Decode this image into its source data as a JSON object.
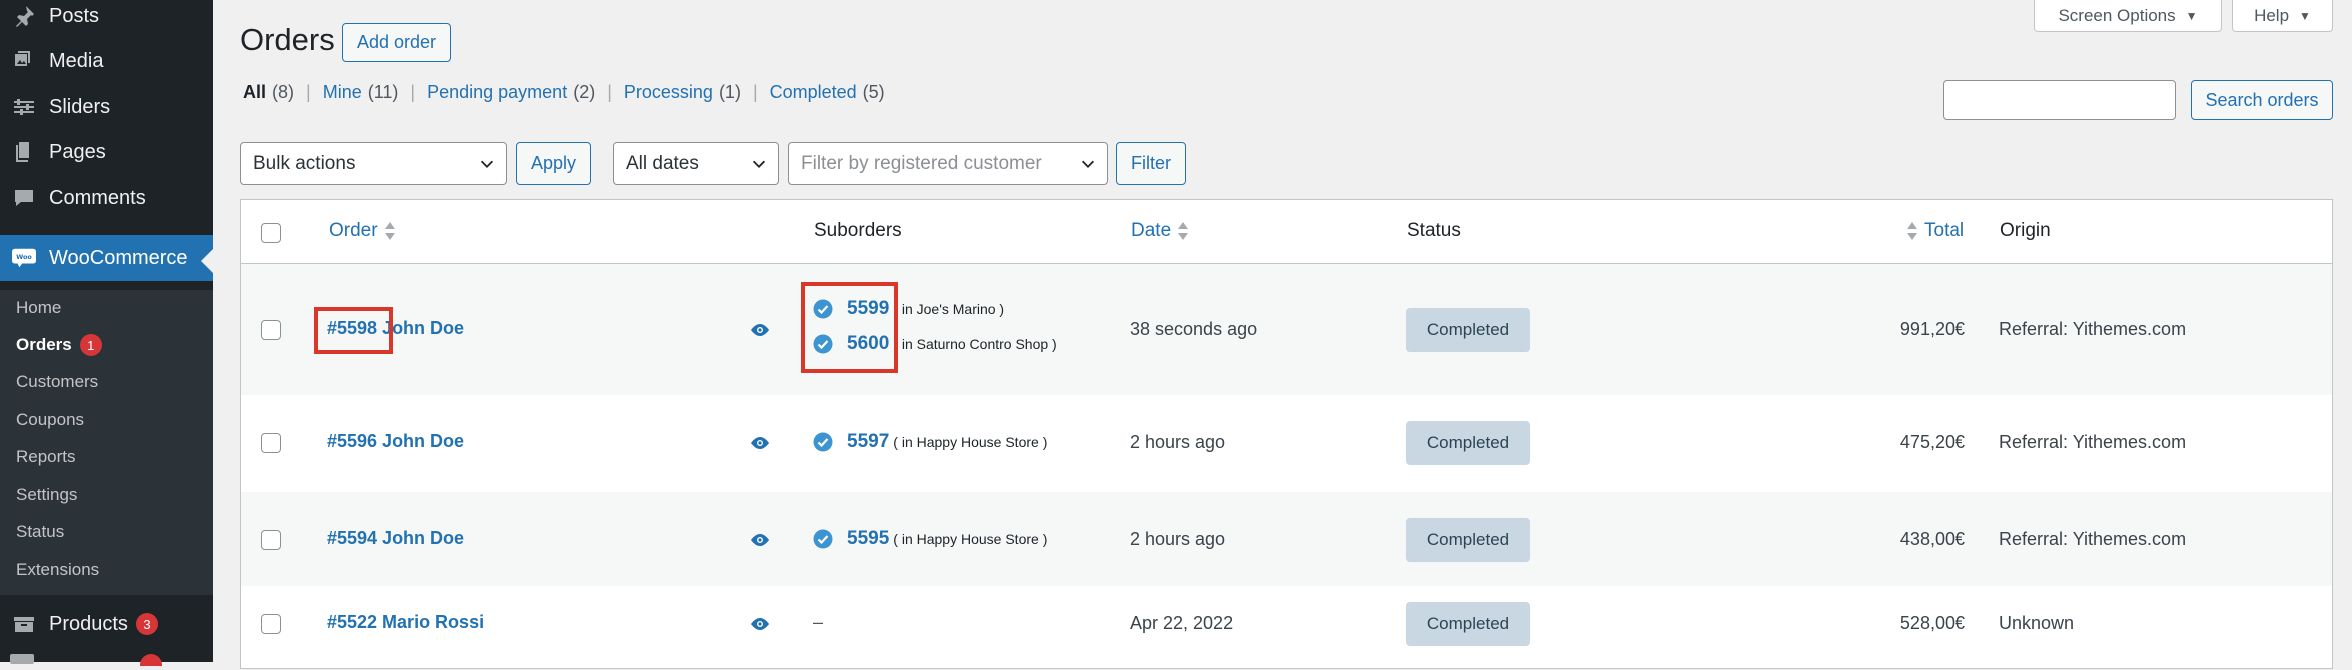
{
  "sidebar": {
    "top_items": [
      {
        "label": "Posts",
        "icon": "pin-icon"
      },
      {
        "label": "Media",
        "icon": "media-icon"
      },
      {
        "label": "Sliders",
        "icon": "sliders-icon"
      },
      {
        "label": "Pages",
        "icon": "pages-icon"
      },
      {
        "label": "Comments",
        "icon": "comments-icon"
      }
    ],
    "woocommerce": {
      "label": "WooCommerce",
      "logo_text": "Woo"
    },
    "submenu": [
      {
        "label": "Home"
      },
      {
        "label": "Orders",
        "badge": "1"
      },
      {
        "label": "Customers"
      },
      {
        "label": "Coupons"
      },
      {
        "label": "Reports"
      },
      {
        "label": "Settings"
      },
      {
        "label": "Status"
      },
      {
        "label": "Extensions"
      }
    ],
    "products": {
      "label": "Products",
      "badge": "3"
    }
  },
  "top_tabs": {
    "screen_options": "Screen Options",
    "help": "Help"
  },
  "header": {
    "title": "Orders",
    "add_order": "Add order"
  },
  "views": [
    {
      "label": "All",
      "count": "(8)"
    },
    {
      "label": "Mine",
      "count": "(11)"
    },
    {
      "label": "Pending payment",
      "count": "(2)"
    },
    {
      "label": "Processing",
      "count": "(1)"
    },
    {
      "label": "Completed",
      "count": "(5)"
    }
  ],
  "search": {
    "button": "Search orders",
    "value": ""
  },
  "filters": {
    "bulk_actions": "Bulk actions",
    "apply": "Apply",
    "dates": "All dates",
    "customer_placeholder": "Filter by registered customer",
    "filter": "Filter"
  },
  "columns": {
    "order": "Order",
    "suborders": "Suborders",
    "date": "Date",
    "status": "Status",
    "total": "Total",
    "origin": "Origin"
  },
  "rows": [
    {
      "order": "#5598 John Doe",
      "suborders": [
        {
          "number": "5599",
          "store": "( in Joe's Marino )"
        },
        {
          "number": "5600",
          "store": "( in Saturno Contro Shop )"
        }
      ],
      "date": "38 seconds ago",
      "status": "Completed",
      "total": "991,20€",
      "origin": "Referral: Yithemes.com"
    },
    {
      "order": "#5596 John Doe",
      "suborders": [
        {
          "number": "5597",
          "store": "( in Happy House Store )"
        }
      ],
      "date": "2 hours ago",
      "status": "Completed",
      "total": "475,20€",
      "origin": "Referral: Yithemes.com"
    },
    {
      "order": "#5594 John Doe",
      "suborders": [
        {
          "number": "5595",
          "store": "( in Happy House Store )"
        }
      ],
      "date": "2 hours ago",
      "status": "Completed",
      "total": "438,00€",
      "origin": "Referral: Yithemes.com"
    },
    {
      "order": "#5522 Mario Rossi",
      "suborders_empty": "–",
      "date": "Apr 22, 2022",
      "status": "Completed",
      "total": "528,00€",
      "origin": "Unknown"
    }
  ],
  "colors": {
    "sidebar": "#1d2327",
    "accent": "#2271b1",
    "highlight": "#d9372a",
    "badge": "#d63638",
    "status_completed": "#c8d7e1"
  }
}
